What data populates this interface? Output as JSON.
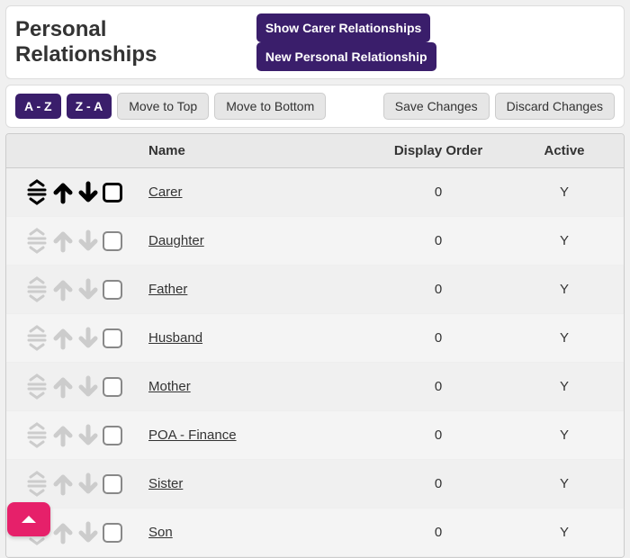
{
  "header": {
    "title": "Personal Relationships",
    "show_carer_btn": "Show Carer Relationships",
    "new_relationship_btn": "New Personal Relationship"
  },
  "toolbar": {
    "sort_az": "A - Z",
    "sort_za": "Z - A",
    "move_top": "Move to Top",
    "move_bottom": "Move to Bottom",
    "save": "Save Changes",
    "discard": "Discard Changes"
  },
  "table": {
    "headers": {
      "name": "Name",
      "order": "Display Order",
      "active": "Active"
    },
    "rows": [
      {
        "name": "Carer",
        "order": "0",
        "active": "Y",
        "selected": true
      },
      {
        "name": "Daughter",
        "order": "0",
        "active": "Y",
        "selected": false
      },
      {
        "name": "Father",
        "order": "0",
        "active": "Y",
        "selected": false
      },
      {
        "name": "Husband",
        "order": "0",
        "active": "Y",
        "selected": false
      },
      {
        "name": "Mother",
        "order": "0",
        "active": "Y",
        "selected": false
      },
      {
        "name": "POA - Finance",
        "order": "0",
        "active": "Y",
        "selected": false
      },
      {
        "name": "Sister",
        "order": "0",
        "active": "Y",
        "selected": false
      },
      {
        "name": "Son",
        "order": "0",
        "active": "Y",
        "selected": false
      }
    ]
  }
}
